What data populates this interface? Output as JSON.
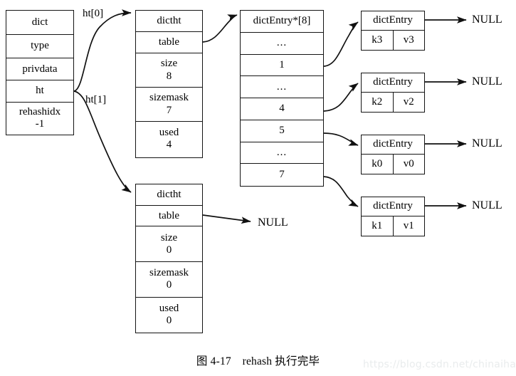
{
  "diagram": {
    "caption": "图 4-17　rehash 执行完毕",
    "watermark": "https://blog.csdn.net/chinaihai"
  },
  "dict": {
    "rows": [
      {
        "label": "dict",
        "value": ""
      },
      {
        "label": "type",
        "value": ""
      },
      {
        "label": "privdata",
        "value": ""
      },
      {
        "label": "ht",
        "value": ""
      },
      {
        "label": "rehashidx",
        "value": "-1"
      }
    ]
  },
  "edge_labels": {
    "ht0": "ht[0]",
    "ht1": "ht[1]"
  },
  "ht0": {
    "rows": [
      {
        "label": "dictht",
        "value": ""
      },
      {
        "label": "table",
        "value": ""
      },
      {
        "label": "size",
        "value": "8"
      },
      {
        "label": "sizemask",
        "value": "7"
      },
      {
        "label": "used",
        "value": "4"
      }
    ]
  },
  "ht1": {
    "rows": [
      {
        "label": "dictht",
        "value": ""
      },
      {
        "label": "table",
        "value": ""
      },
      {
        "label": "size",
        "value": "0"
      },
      {
        "label": "sizemask",
        "value": "0"
      },
      {
        "label": "used",
        "value": "0"
      }
    ],
    "table_target": "NULL"
  },
  "bucket_array": {
    "header": "dictEntry*[8]",
    "slots": [
      "...",
      "1",
      "...",
      "4",
      "5",
      "...",
      "7"
    ]
  },
  "entries": [
    {
      "title": "dictEntry",
      "key": "k3",
      "value": "v3",
      "next": "NULL"
    },
    {
      "title": "dictEntry",
      "key": "k2",
      "value": "v2",
      "next": "NULL"
    },
    {
      "title": "dictEntry",
      "key": "k0",
      "value": "v0",
      "next": "NULL"
    },
    {
      "title": "dictEntry",
      "key": "k1",
      "value": "v1",
      "next": "NULL"
    }
  ]
}
